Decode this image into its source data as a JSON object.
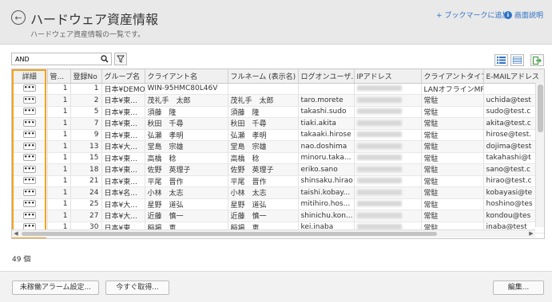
{
  "header": {
    "title": "ハードウェア資産情報",
    "subtitle": "ハードウェア資産情報の一覧です。",
    "bookmark_label": "+ ブックマークに追加",
    "help_label": "画面説明"
  },
  "toolbar": {
    "search_value": "AND"
  },
  "table": {
    "columns": [
      "詳細",
      "管...",
      "登録No",
      "グループ名",
      "クライアント名",
      "フルネーム (表示名)",
      "ログオンユーザ...",
      "IPアドレス",
      "クライアントタイプ",
      "E-MAILアドレス"
    ],
    "detail_label": "•••",
    "rows": [
      [
        "1",
        "1",
        "日本¥DEMO",
        "WIN-95HMC80L46V",
        "",
        "",
        "",
        "LANオフラインMR",
        ""
      ],
      [
        "1",
        "2",
        "日本¥東...",
        "茂礼手　太郎",
        "茂礼手　太郎",
        "taro.morete",
        "",
        "常駐",
        "uchida@test"
      ],
      [
        "1",
        "5",
        "日本¥東...",
        "須藤　隆",
        "須藤　隆",
        "takashi.sudo",
        "",
        "常駐",
        "sudo@test.c"
      ],
      [
        "1",
        "7",
        "日本¥東...",
        "秋田　千尋",
        "秋田　千尋",
        "tiaki.akita",
        "",
        "常駐",
        "akita@test.c"
      ],
      [
        "1",
        "9",
        "日本¥東...",
        "弘瀬　孝明",
        "弘瀬　孝明",
        "takaaki.hirose",
        "",
        "常駐",
        "hirose@test."
      ],
      [
        "1",
        "13",
        "日本¥大...",
        "堂島　宗雄",
        "堂島　宗雄",
        "nao.doshima",
        "",
        "常駐",
        "dojima@test"
      ],
      [
        "1",
        "15",
        "日本¥東...",
        "高橋　稔",
        "高橋　稔",
        "minoru.taka...",
        "",
        "常駐",
        "takahashi@t"
      ],
      [
        "1",
        "18",
        "日本¥東...",
        "佐野　英理子",
        "佐野　英理子",
        "eriko.sano",
        "",
        "常駐",
        "sano@test.c"
      ],
      [
        "1",
        "21",
        "日本¥東...",
        "平尾　晋作",
        "平尾　晋作",
        "shinsaku.hirao",
        "",
        "常駐",
        "hirao@test.c"
      ],
      [
        "1",
        "24",
        "日本¥名...",
        "小林　太志",
        "小林　太志",
        "taishi.kobay...",
        "",
        "常駐",
        "kobayasi@te"
      ],
      [
        "1",
        "25",
        "日本¥大...",
        "星野　道弘",
        "星野　道弘",
        "mitihiro.hos...",
        "",
        "常駐",
        "hoshino@tes"
      ],
      [
        "1",
        "27",
        "日本¥大...",
        "近藤　慎一",
        "近藤　慎一",
        "shinichu.kon...",
        "",
        "常駐",
        "kondou@tes"
      ],
      [
        "1",
        "30",
        "日本¥東...",
        "稲場　恵",
        "稲場　恵",
        "kei.inaba",
        "",
        "常駐",
        "inaba@test"
      ]
    ]
  },
  "record_count": "49 個",
  "footer": {
    "alarm_button": "未稼働アラーム設定...",
    "fetch_button": "今すぐ取得...",
    "edit_button": "編集..."
  },
  "colors": {
    "highlight": "#f5a31f",
    "link": "#2f73c4"
  }
}
